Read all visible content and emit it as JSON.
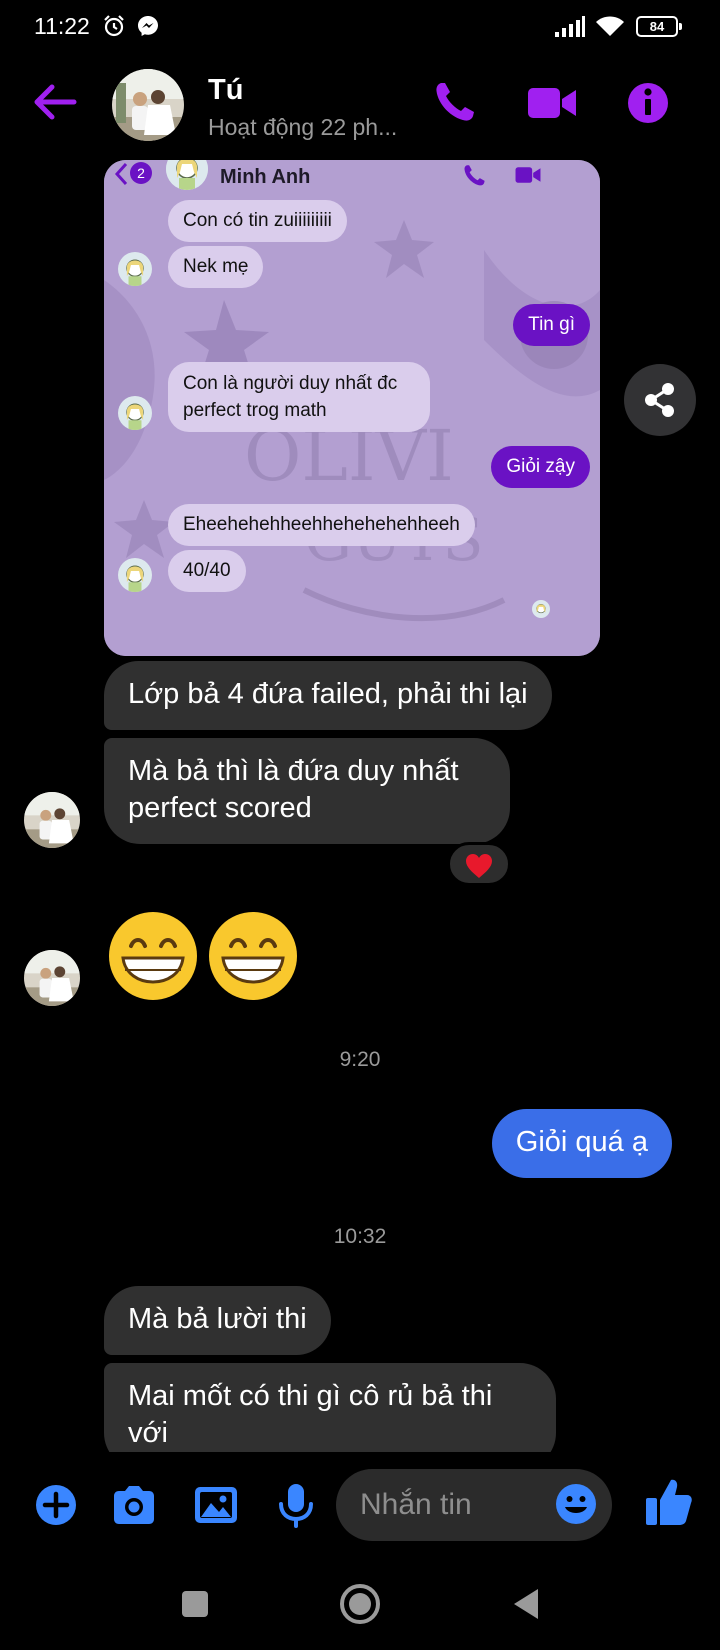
{
  "status_bar": {
    "time": "11:22",
    "battery": "84"
  },
  "header": {
    "contact_name": "Tú",
    "contact_status": "Hoạt động 22 ph..."
  },
  "shared_screenshot": {
    "contact_name": "Minh Anh",
    "unread_count": "2",
    "messages": [
      {
        "from": "them",
        "text": "Con có tin zuiiiiiiiii"
      },
      {
        "from": "them",
        "text": "Nek mẹ"
      },
      {
        "from": "me",
        "text": "Tin gì"
      },
      {
        "from": "them",
        "text": "Con là người duy nhất đc perfect trog math"
      },
      {
        "from": "me",
        "text": "Giỏi zậy"
      },
      {
        "from": "them",
        "text": "Eheehehehheehhehehehehheeh"
      },
      {
        "from": "them",
        "text": "40/40"
      }
    ]
  },
  "messages": {
    "m1": "Lớp bả 4 đứa failed, phải thi lại",
    "m2": "Mà bả thì là đứa duy nhất perfect scored",
    "reaction": "❤️",
    "emojis": [
      "😁",
      "😁"
    ],
    "time1": "9:20",
    "m3": "Giỏi quá ạ",
    "time2": "10:32",
    "m4": "Mà bả lười thi",
    "m5": "Mai mốt có thi gì cô rủ bả thi với"
  },
  "composer": {
    "placeholder": "Nhắn tin"
  },
  "colors": {
    "accent": "#a020f0",
    "bubble_out": "#3a6ee8",
    "bubble_in": "#303030",
    "composer_icon": "#3a86ff"
  }
}
